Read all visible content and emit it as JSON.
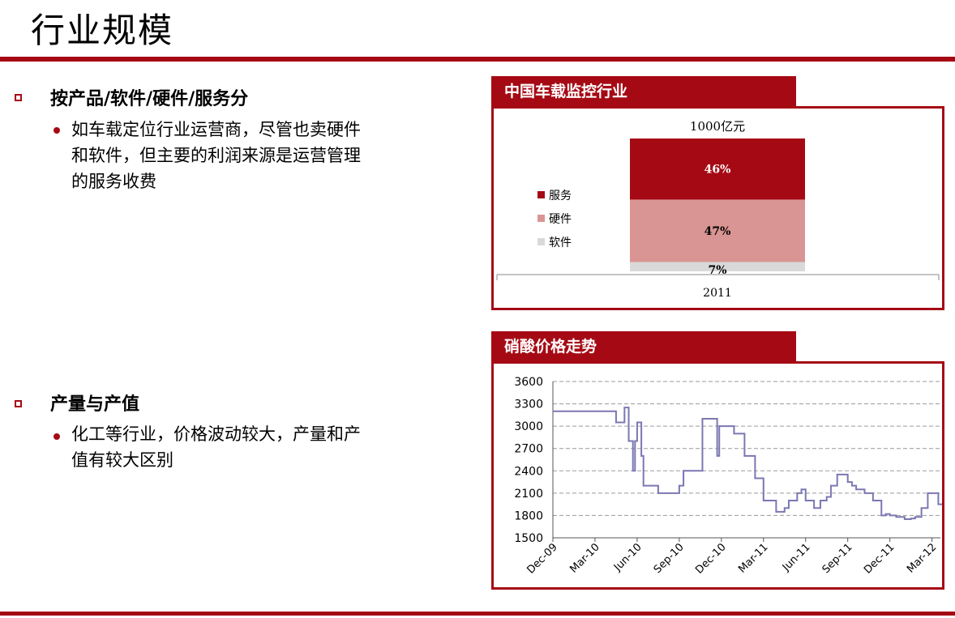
{
  "slide": {
    "title": "行业规模",
    "sections": [
      {
        "heading": "按产品/软件/硬件/服务分",
        "points": [
          {
            "lines": [
              "如车载定位行业运营商，尽管也卖硬件",
              "和软件，但主要的利润来源是运营管理",
              "的服务收费"
            ]
          }
        ]
      },
      {
        "heading": "产量与产值",
        "points": [
          {
            "lines": [
              "化工等行业，价格波动较大，产量和产",
              "值有较大区别"
            ]
          }
        ]
      }
    ]
  },
  "colors": {
    "accent": "#a50a14",
    "service": "#a50a14",
    "hardware": "#d99593",
    "software": "#d9d9d9",
    "price_line": "#7b77b3"
  },
  "chart_data": [
    {
      "type": "bar",
      "panel_title": "中国车载监控行业",
      "title": "1000亿元",
      "categories": [
        "2011"
      ],
      "stacked": true,
      "series": [
        {
          "name": "软件",
          "values": [
            7
          ],
          "label": "7%"
        },
        {
          "name": "硬件",
          "values": [
            47
          ],
          "label": "47%"
        },
        {
          "name": "服务",
          "values": [
            46
          ],
          "label": "46%"
        }
      ],
      "legend": [
        "服务",
        "硬件",
        "软件"
      ],
      "legend_position": "left"
    },
    {
      "type": "line",
      "panel_title": "硝酸价格走势",
      "ylim": [
        1500,
        3600
      ],
      "yticks": [
        1500,
        1800,
        2100,
        2400,
        2700,
        3000,
        3300,
        3600
      ],
      "xticks": [
        "Dec-09",
        "Mar-10",
        "Jun-10",
        "Sep-10",
        "Dec-10",
        "Mar-11",
        "Jun-11",
        "Sep-11",
        "Dec-11",
        "Mar-12"
      ],
      "grid": true,
      "series": [
        {
          "x": [
            0,
            1.4,
            1.5,
            1.7,
            1.8,
            1.9,
            1.95,
            2.0,
            2.1,
            2.15,
            2.25,
            2.3,
            2.4,
            2.5,
            3.0,
            3.05,
            3.1,
            3.2,
            3.35,
            3.55,
            3.9,
            3.95,
            4.1,
            4.3,
            4.35,
            4.5,
            4.55,
            4.8,
            5.0,
            5.3,
            5.4,
            5.5,
            5.6,
            5.8,
            5.9,
            6.0,
            6.2,
            6.35,
            6.5,
            6.6,
            6.75,
            7.0,
            7.1,
            7.2,
            7.4,
            7.6,
            7.8,
            7.9,
            8.0,
            8.15,
            8.35,
            8.5,
            8.6,
            8.75,
            8.9,
            9.0,
            9.15,
            9.3,
            9.4,
            9.55,
            9.7,
            9.9
          ],
          "y": [
            3200,
            3200,
            3050,
            3250,
            2800,
            2400,
            2800,
            3050,
            2600,
            2200,
            2200,
            2200,
            2200,
            2100,
            2200,
            2200,
            2400,
            2400,
            2400,
            3100,
            2600,
            3000,
            3000,
            2900,
            2900,
            2900,
            2600,
            2300,
            2000,
            1850,
            1850,
            1900,
            2000,
            2100,
            2150,
            2000,
            1900,
            2000,
            2050,
            2200,
            2350,
            2250,
            2200,
            2150,
            2100,
            2000,
            1800,
            1820,
            1800,
            1780,
            1750,
            1760,
            1780,
            1900,
            2100,
            2100,
            1950,
            1900,
            1950,
            2000,
            2000,
            2000
          ]
        }
      ]
    }
  ]
}
